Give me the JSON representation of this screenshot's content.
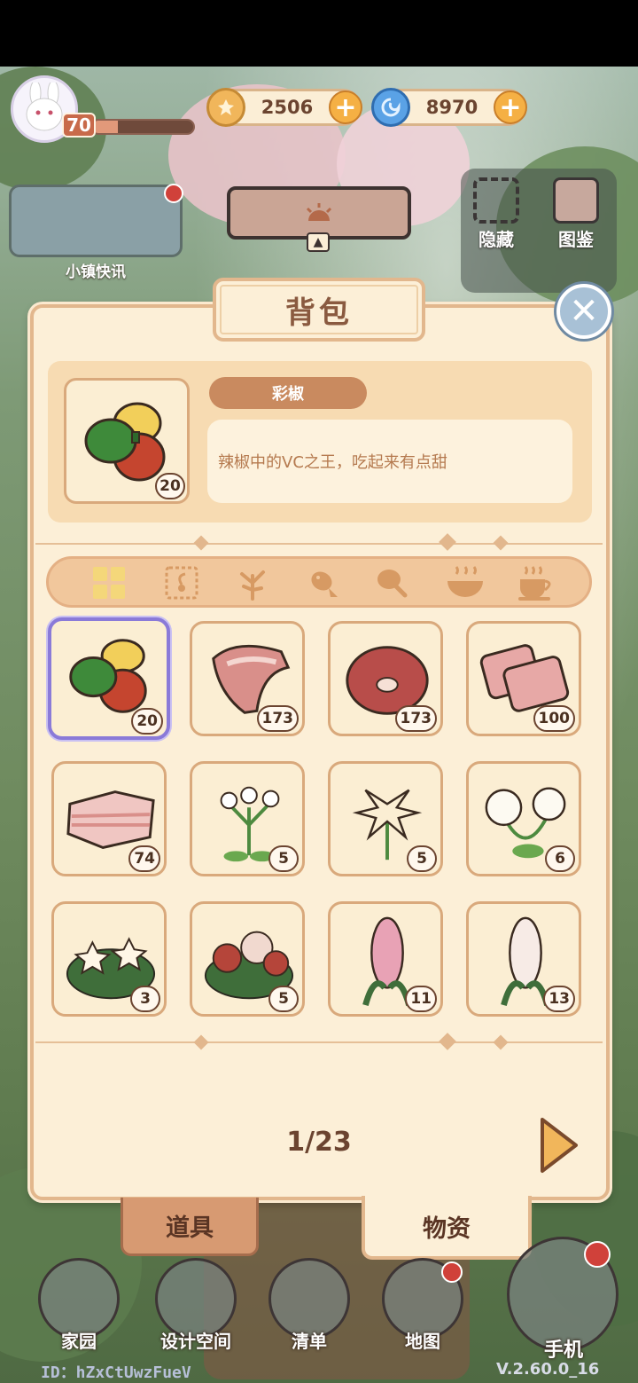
{
  "hud": {
    "level": "70",
    "xp_progress": 0.25,
    "gold": "2506",
    "gems": "8970",
    "news_label": "小镇快讯",
    "hide_label": "隐藏",
    "guide_label": "图鉴"
  },
  "backpack": {
    "title": "背包",
    "selected": {
      "name": "彩椒",
      "description": "辣椒中的VC之王，吃起来有点甜",
      "count": "20",
      "icon": "bell-pepper-icon"
    },
    "categories": [
      {
        "name": "all",
        "icon": "grid-icon"
      },
      {
        "name": "seeds",
        "icon": "seed-packet-icon"
      },
      {
        "name": "plants",
        "icon": "sprout-icon"
      },
      {
        "name": "fish",
        "icon": "fish-icon"
      },
      {
        "name": "meat",
        "icon": "drumstick-icon"
      },
      {
        "name": "dishes",
        "icon": "hot-bowl-icon"
      },
      {
        "name": "drinks",
        "icon": "tea-cup-icon"
      }
    ],
    "items": [
      {
        "icon": "bell-pepper-icon",
        "count": "20"
      },
      {
        "icon": "ribs-meat-icon",
        "count": "173"
      },
      {
        "icon": "steak-icon",
        "count": "173"
      },
      {
        "icon": "bacon-icon",
        "count": "100"
      },
      {
        "icon": "pork-belly-icon",
        "count": "74"
      },
      {
        "icon": "white-flower-icon",
        "count": "5"
      },
      {
        "icon": "lily-flower-icon",
        "count": "5"
      },
      {
        "icon": "white-peony-icon",
        "count": "6"
      },
      {
        "icon": "jasmine-bush-icon",
        "count": "3"
      },
      {
        "icon": "red-peony-bush-icon",
        "count": "5"
      },
      {
        "icon": "pink-hyacinth-icon",
        "count": "11"
      },
      {
        "icon": "white-hyacinth-icon",
        "count": "13"
      }
    ],
    "page": "1/23",
    "tabs": {
      "tools": "道具",
      "materials": "物资"
    }
  },
  "nav": {
    "home": "家园",
    "design": "设计空间",
    "list": "清单",
    "map": "地图",
    "phone": "手机"
  },
  "footer": {
    "id": "ID：hZxCtUwzFueV",
    "version": "V.2.60.0_16"
  },
  "colors": {
    "panel_bg": "#fcefd7",
    "panel_border": "#e2b78d",
    "text_brown": "#6b4430",
    "selected_border": "#8a7ad8",
    "accent_orange": "#f5b044"
  }
}
